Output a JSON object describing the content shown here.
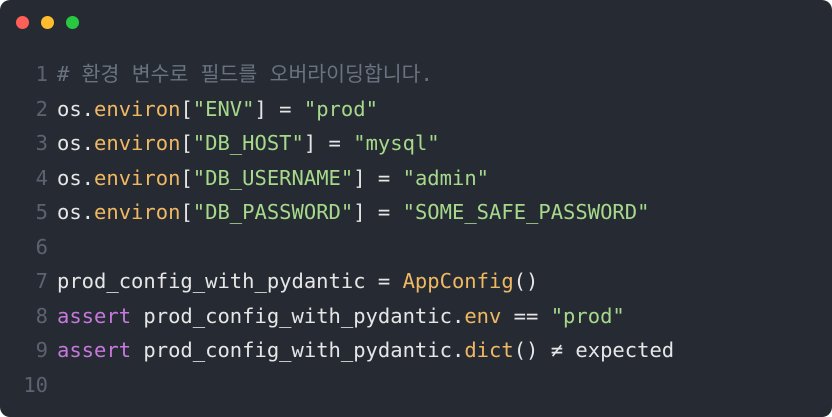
{
  "window": {
    "controls": {
      "close": "close",
      "minimize": "minimize",
      "zoom": "zoom"
    }
  },
  "code": {
    "lines": [
      {
        "number": "1",
        "tokens": [
          {
            "t": "# 환경 변수로 필드를 오버라이딩합니다.",
            "c": "comment"
          }
        ]
      },
      {
        "number": "2",
        "tokens": [
          {
            "t": "os.",
            "c": "plain"
          },
          {
            "t": "environ",
            "c": "fn"
          },
          {
            "t": "[",
            "c": "plain"
          },
          {
            "t": "\"ENV\"",
            "c": "str"
          },
          {
            "t": "] = ",
            "c": "plain"
          },
          {
            "t": "\"prod\"",
            "c": "str"
          }
        ]
      },
      {
        "number": "3",
        "tokens": [
          {
            "t": "os.",
            "c": "plain"
          },
          {
            "t": "environ",
            "c": "fn"
          },
          {
            "t": "[",
            "c": "plain"
          },
          {
            "t": "\"DB_HOST\"",
            "c": "str"
          },
          {
            "t": "] = ",
            "c": "plain"
          },
          {
            "t": "\"mysql\"",
            "c": "str"
          }
        ]
      },
      {
        "number": "4",
        "tokens": [
          {
            "t": "os.",
            "c": "plain"
          },
          {
            "t": "environ",
            "c": "fn"
          },
          {
            "t": "[",
            "c": "plain"
          },
          {
            "t": "\"DB_USERNAME\"",
            "c": "str"
          },
          {
            "t": "] = ",
            "c": "plain"
          },
          {
            "t": "\"admin\"",
            "c": "str"
          }
        ]
      },
      {
        "number": "5",
        "tokens": [
          {
            "t": "os.",
            "c": "plain"
          },
          {
            "t": "environ",
            "c": "fn"
          },
          {
            "t": "[",
            "c": "plain"
          },
          {
            "t": "\"DB_PASSWORD\"",
            "c": "str"
          },
          {
            "t": "] = ",
            "c": "plain"
          },
          {
            "t": "\"SOME_SAFE_PASSWORD\"",
            "c": "str"
          }
        ]
      },
      {
        "number": "6",
        "tokens": []
      },
      {
        "number": "7",
        "tokens": [
          {
            "t": "prod_config_with_pydantic = ",
            "c": "plain"
          },
          {
            "t": "AppConfig",
            "c": "fn"
          },
          {
            "t": "()",
            "c": "plain"
          }
        ]
      },
      {
        "number": "8",
        "tokens": [
          {
            "t": "assert",
            "c": "kw"
          },
          {
            "t": " prod_config_with_pydantic.",
            "c": "plain"
          },
          {
            "t": "env",
            "c": "fn"
          },
          {
            "t": " == ",
            "c": "plain"
          },
          {
            "t": "\"prod\"",
            "c": "str"
          }
        ]
      },
      {
        "number": "9",
        "tokens": [
          {
            "t": "assert",
            "c": "kw"
          },
          {
            "t": " prod_config_with_pydantic.",
            "c": "plain"
          },
          {
            "t": "dict",
            "c": "fn"
          },
          {
            "t": "() ≠ expected",
            "c": "plain"
          }
        ]
      },
      {
        "number": "10",
        "tokens": []
      }
    ]
  },
  "colors": {
    "background": "#262b33",
    "comment": "#6b7280",
    "function": "#f0b863",
    "string": "#a6d98b",
    "keyword": "#c678dd",
    "text": "#e6e6e6",
    "line_number": "#5c6370"
  }
}
